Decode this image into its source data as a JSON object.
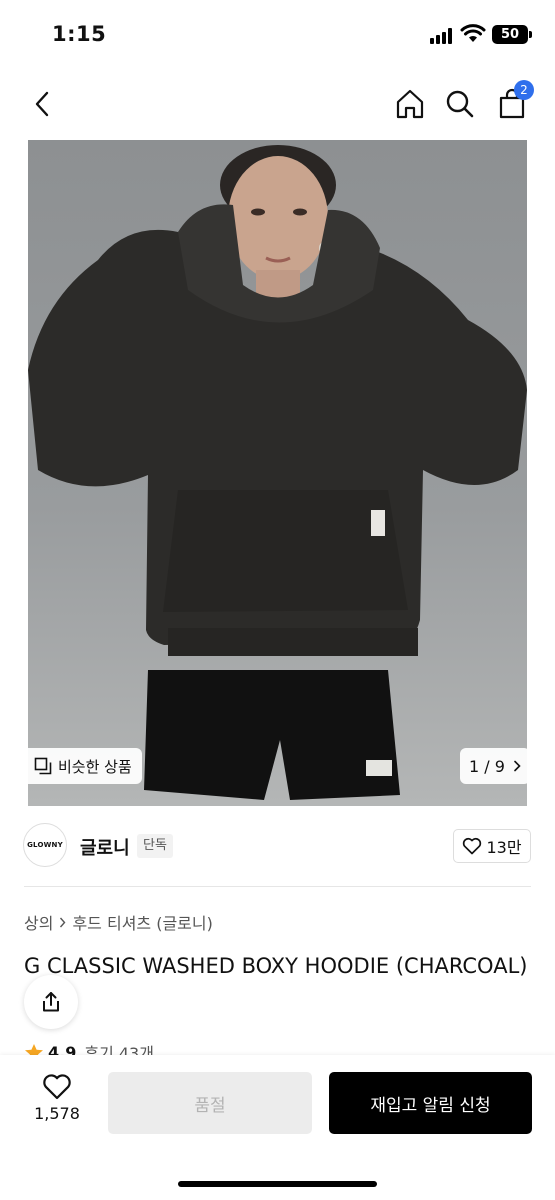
{
  "status_bar": {
    "time": "1:15",
    "battery": "50"
  },
  "nav": {
    "cart_count": "2"
  },
  "photo": {
    "similar_label": "비슷한 상품",
    "page_indicator": "1 / 9"
  },
  "brand": {
    "logo_text": "GLOWNY",
    "name": "글로니",
    "exclusive_label": "단독",
    "like_count": "13만"
  },
  "breadcrumb": {
    "category": "상의",
    "subcategory": "후드 티셔츠 (글로니)"
  },
  "product": {
    "title": "G CLASSIC WASHED BOXY HOODIE (CHARCOAL)",
    "rating": "4.9",
    "reviews_label": "후기 43개"
  },
  "bottom_bar": {
    "wish_count": "1,578",
    "soldout_label": "품절",
    "restock_label": "재입고 알림 신청"
  },
  "colors": {
    "accent": "#2f6fec",
    "star": "#f5a623",
    "cta": "#000000"
  }
}
